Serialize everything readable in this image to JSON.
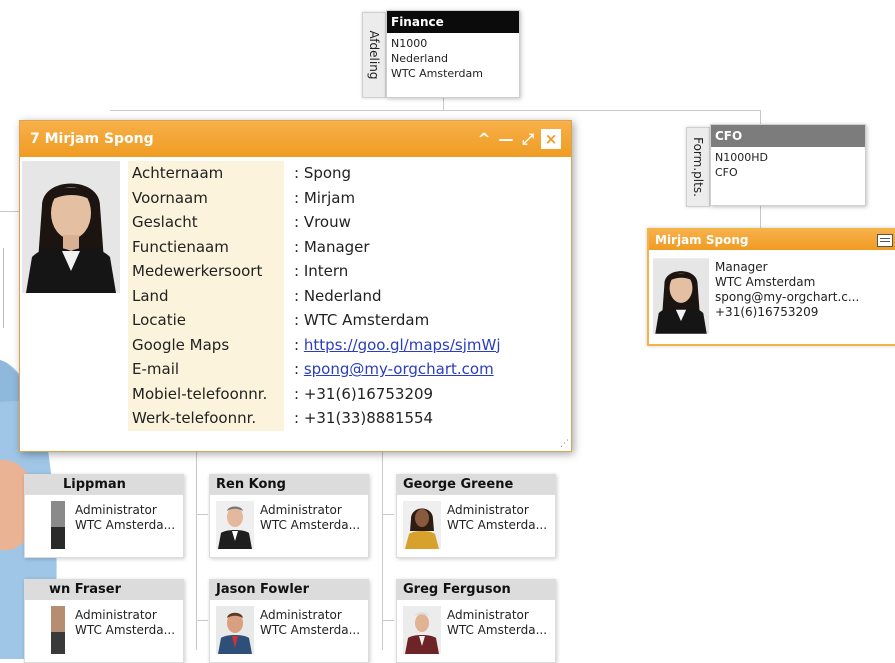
{
  "department": {
    "vertical_label": "Afdeling",
    "title": "Finance",
    "lines": [
      "N1000",
      "Nederland",
      "WTC Amsterdam"
    ]
  },
  "position": {
    "vertical_label": "Form.plts.",
    "title": "CFO",
    "lines": [
      "N1000HD",
      "CFO"
    ]
  },
  "popup": {
    "title": "7 Mirjam Spong",
    "buttons": {
      "collapse": "^",
      "minimize": "—",
      "maximize": "⤢",
      "close": "×"
    },
    "fields": [
      {
        "label": "Achternaam",
        "value": ": Spong"
      },
      {
        "label": "Voornaam",
        "value": ": Mirjam"
      },
      {
        "label": "Geslacht",
        "value": ": Vrouw"
      },
      {
        "label": "Functienaam",
        "value": ": Manager"
      },
      {
        "label": "Medewerkersoort",
        "value": ": Intern"
      },
      {
        "label": "Land",
        "value": ": Nederland"
      },
      {
        "label": "Locatie",
        "value": ": WTC Amsterdam"
      },
      {
        "label": "Google Maps",
        "colon": ": ",
        "link": "https://goo.gl/maps/sjmWj"
      },
      {
        "label": "E-mail",
        "colon": ": ",
        "link": "spong@my-orgchart.com"
      },
      {
        "label": "Mobiel-telefoonnr.",
        "value": ": +31(6)16753209"
      },
      {
        "label": "Werk-telefoonnr.",
        "value": ": +31(33)8881554"
      }
    ]
  },
  "manager_card": {
    "name": "Mirjam Spong",
    "lines": [
      "Manager",
      "WTC Amsterdam",
      "spong@my-orgchart.c...",
      "+31(6)16753209"
    ]
  },
  "employees": [
    {
      "name": "Lippman",
      "role": "Administrator",
      "location": "WTC Amsterda..."
    },
    {
      "name": "Ren Kong",
      "role": "Administrator",
      "location": "WTC Amsterda..."
    },
    {
      "name": "George Greene",
      "role": "Administrator",
      "location": "WTC Amsterda..."
    },
    {
      "name": "wn Fraser",
      "role": "Administrator",
      "location": "WTC Amsterda..."
    },
    {
      "name": "Jason Fowler",
      "role": "Administrator",
      "location": "WTC Amsterda..."
    },
    {
      "name": "Greg Ferguson",
      "role": "Administrator",
      "location": "WTC Amsterda..."
    }
  ],
  "colors": {
    "accent": "#ef9c22",
    "header_dark": "#0b0b0b",
    "header_grey": "#7c7c7c",
    "link": "#2a3dbf"
  }
}
